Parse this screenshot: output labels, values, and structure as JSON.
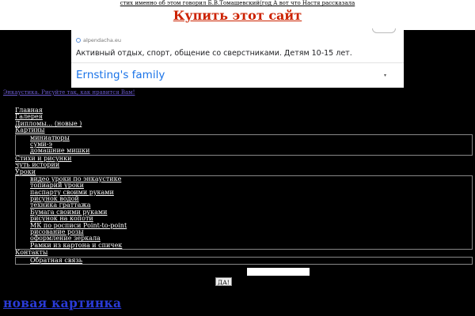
{
  "top_banner": {
    "line": "стих именно об этом говорил Б.В.Томашевский(год А вот что Настя рассказала",
    "buy_link": "Купить этот сайт"
  },
  "ad": {
    "domain": "alpendacha.eu",
    "description": "Активный отдых, спорт, общение со сверстниками. Детям 10-15 лет.",
    "brand": "Ernsting's family",
    "arrow": "▾"
  },
  "site_link": "Энкаустика. Рисуйте так, как нравится Вам!",
  "nav": {
    "home": "Главная",
    "gallery": "Галерея",
    "diplomas": "Дипломы... (новые )",
    "pictures": "Картины",
    "pictures_sub": [
      "миниатюры",
      "суми-э",
      "домашние мишки"
    ],
    "poems": "Стихи и рисунки",
    "stories": "чуть истории",
    "lessons": "Уроки",
    "lessons_sub": [
      "видео уроки по энкаустике",
      "топиарий уроки",
      "паспарту своими руками",
      "рисунок водой",
      "техника граттажа",
      "Бумага своими руками",
      "рисунок на копоти",
      "МК по росписи Point-to-point",
      "рисование розы",
      "оформление зеркала",
      "Рамки из картона и спичек"
    ],
    "contacts": "Контакты",
    "contacts_sub": [
      "Обратная связь"
    ]
  },
  "yes_button": "ДА!",
  "new_picture_link": "новая картинка"
}
